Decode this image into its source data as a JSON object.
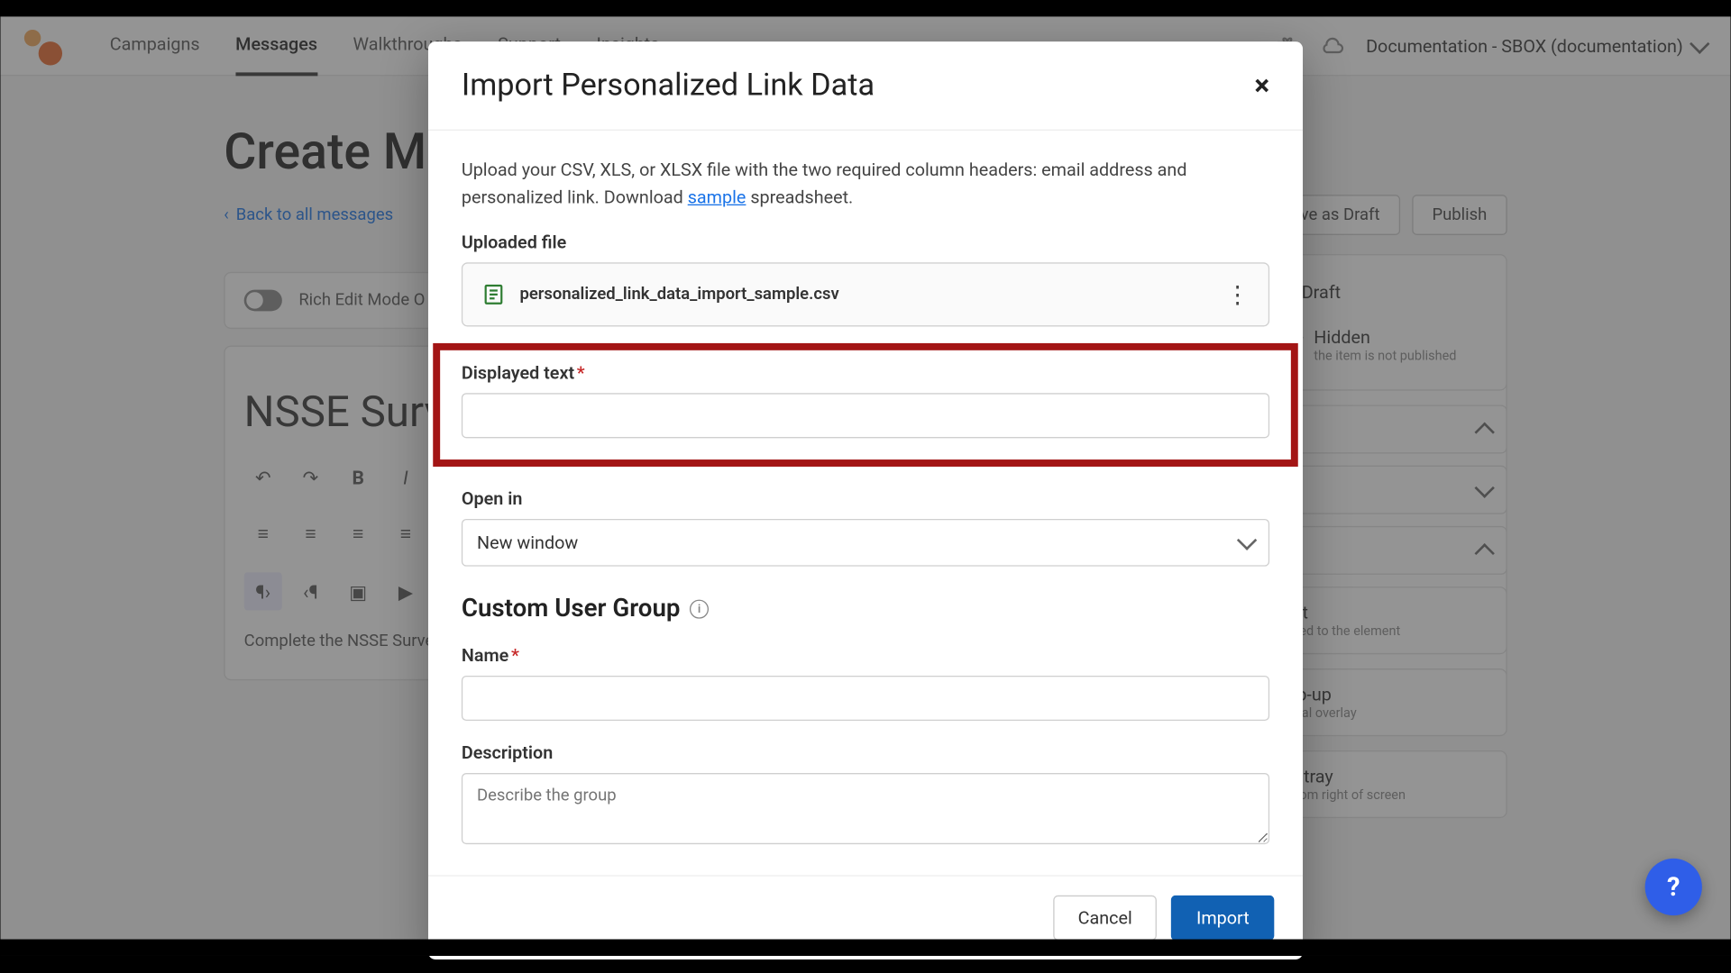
{
  "nav": {
    "items": [
      "Campaigns",
      "Messages",
      "Walkthroughs",
      "Support",
      "Insights"
    ],
    "active_index": 1
  },
  "account_label": "Documentation - SBOX (documentation)",
  "page": {
    "title_prefix": "Create M",
    "back_link": "Back to all messages",
    "save_draft": "Save as Draft",
    "publish": "Publish",
    "rich_mode": "Rich Edit Mode O",
    "doc_title": "NSSE Surv",
    "editor_body_snippet": "Complete the NSSE Surve"
  },
  "sidebar": {
    "status_draft": "Draft",
    "status_hidden": "Hidden",
    "status_hidden_sub": "the item is not published",
    "hint_title": "Hint",
    "hint_sub": "Linked to the element",
    "popup_title": "Pop-up",
    "popup_sub": "Modal overlay",
    "systray_title": "Systray",
    "systray_sub": "Bottom right of screen"
  },
  "modal": {
    "title": "Import Personalized Link Data",
    "help_pre": "Upload your CSV, XLS, or XLSX file with the two required column headers: email address and personalized link. Download ",
    "help_link": "sample",
    "help_post": " spreadsheet.",
    "uploaded_label": "Uploaded file",
    "file_name": "personalized_link_data_import_sample.csv",
    "displayed_text_label": "Displayed text",
    "open_in_label": "Open in",
    "open_in_value": "New window",
    "group_heading": "Custom User Group",
    "name_label": "Name",
    "desc_label": "Description",
    "desc_placeholder": "Describe the group",
    "cancel": "Cancel",
    "import": "Import"
  }
}
